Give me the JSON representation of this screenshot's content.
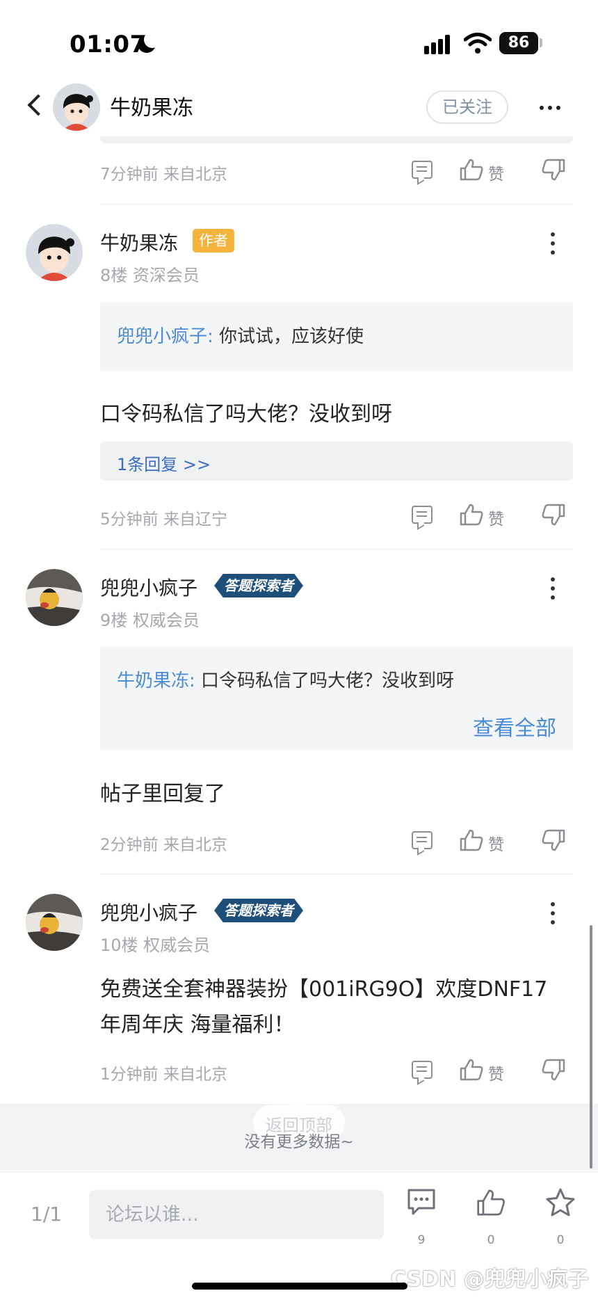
{
  "status_bar": {
    "time": "01:07",
    "battery": "86"
  },
  "header": {
    "title": "牛奶果冻",
    "follow_label": "已关注"
  },
  "comments": [
    {
      "meta": "7分钟前 来自北京",
      "like_label": "赞"
    },
    {
      "user": "牛奶果冻",
      "badge": "作者",
      "floor": "8楼 资深会员",
      "quote_user": "兜兜小疯子:",
      "quote_text": "你试试，应该好使",
      "content": "口令码私信了吗大佬？没收到呀",
      "reply_link": "1条回复 >>",
      "meta": "5分钟前 来自辽宁",
      "like_label": "赞"
    },
    {
      "user": "兜兜小疯子",
      "badge": "答题探索者",
      "floor": "9楼 权威会员",
      "quote_user": "牛奶果冻:",
      "quote_text": "口令码私信了吗大佬？没收到呀",
      "view_all": "查看全部",
      "content": "帖子里回复了",
      "meta": "2分钟前 来自北京",
      "like_label": "赞"
    },
    {
      "user": "兜兜小疯子",
      "badge": "答题探索者",
      "floor": "10楼 权威会员",
      "content_line1": "免费送全套神器装扮【001iRG9O】欢度DNF17",
      "content_line2": "年周年庆 海量福利！",
      "meta": "1分钟前 来自北京",
      "like_label": "赞"
    }
  ],
  "back_to_top": "返回顶部",
  "no_more": "没有更多数据~",
  "bottom_bar": {
    "pager": "1/1",
    "input_placeholder": "论坛以谁...",
    "comment_count": "9",
    "like_count": "0",
    "favorite_count": "0"
  },
  "watermark": "CSDN @兜兜小疯子"
}
